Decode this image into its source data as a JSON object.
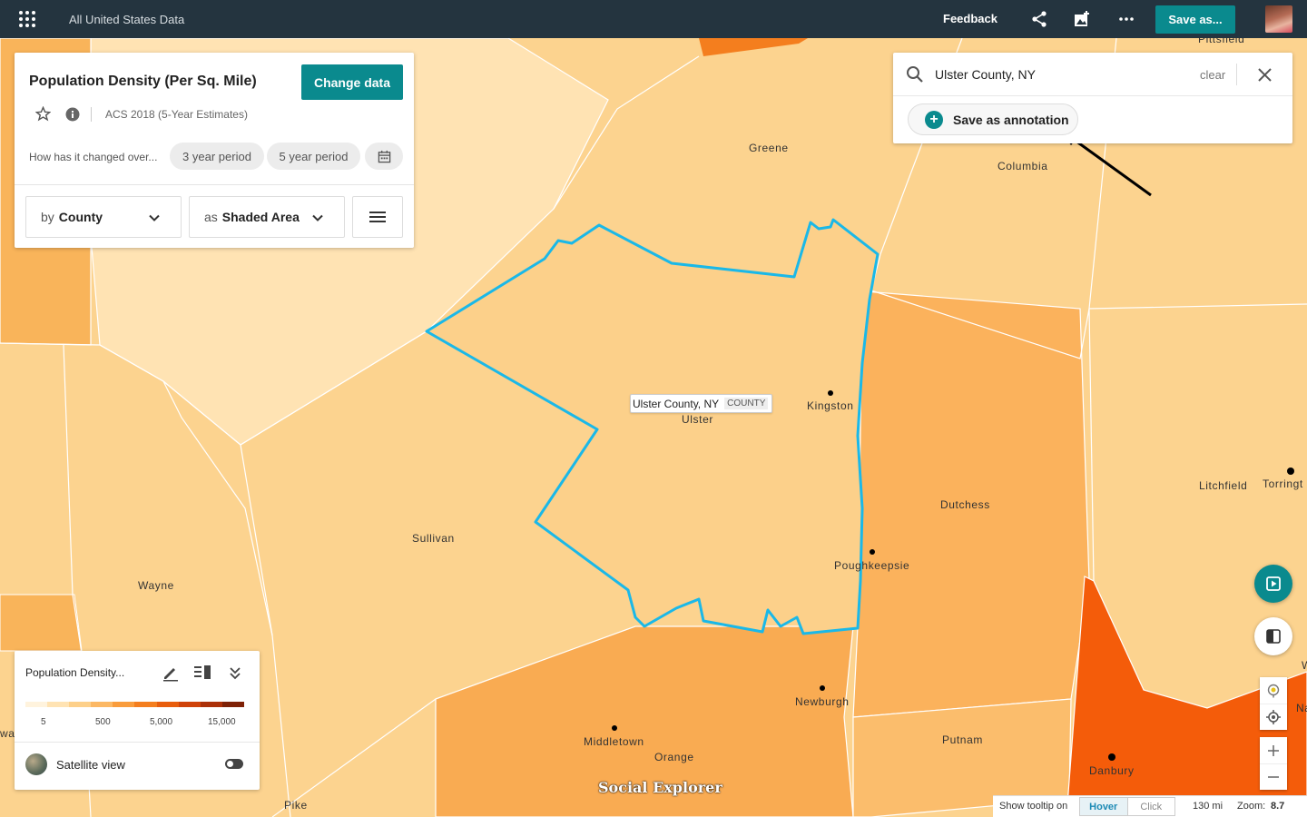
{
  "topbar": {
    "app_title": "All United States Data",
    "feedback_label": "Feedback",
    "save_as_label": "Save as..."
  },
  "data_panel": {
    "title": "Population Density (Per Sq. Mile)",
    "change_data_label": "Change data",
    "survey": "ACS 2018 (5-Year Estimates)",
    "change_prompt": "How has it changed over...",
    "period_3": "3 year period",
    "period_5": "5 year period",
    "geo_prefix": "by",
    "geo_value": "County",
    "viz_prefix": "as",
    "viz_value": "Shaded Area"
  },
  "search": {
    "value": "Ulster County, NY",
    "clear_label": "clear",
    "annotation_label": "Save as annotation"
  },
  "tooltip": {
    "name": "Ulster County, NY",
    "type": "COUNTY"
  },
  "map_labels": {
    "pittsfield": "Pittsfield",
    "greene": "Greene",
    "columbia": "Columbia",
    "ulster": "Ulster",
    "kingston": "Kingston",
    "torrington": "Torringt",
    "litchfield": "Litchfield",
    "dutchess": "Dutchess",
    "sullivan": "Sullivan",
    "poughkeepsie": "Poughkeepsie",
    "wayne": "Wayne",
    "newburgh": "Newburgh",
    "middletown": "Middletown",
    "orange": "Orange",
    "putnam": "Putnam",
    "danbury": "Danbury",
    "pike": "Pike",
    "wa": "wa",
    "na": "Na",
    "w": "W"
  },
  "legend": {
    "title": "Population Density...",
    "colors": [
      "#fff3dd",
      "#ffe3b3",
      "#fdd08a",
      "#fcb864",
      "#f99c3c",
      "#f47e1e",
      "#e85d0c",
      "#cf4209",
      "#ab3008",
      "#7e2106"
    ],
    "ticks": [
      "5",
      "500",
      "5,000",
      "15,000"
    ],
    "satellite_label": "Satellite view"
  },
  "status": {
    "tooltip_label": "Show tooltip on",
    "hover_label": "Hover",
    "click_label": "Click",
    "scale": "130 mi",
    "zoom_label": "Zoom:",
    "zoom_value": "8.7"
  },
  "watermark": "Social Explorer",
  "colors": {
    "accent": "#0a8a8e",
    "topbar": "#24343f",
    "highlight_outline": "#1ab8e8"
  }
}
